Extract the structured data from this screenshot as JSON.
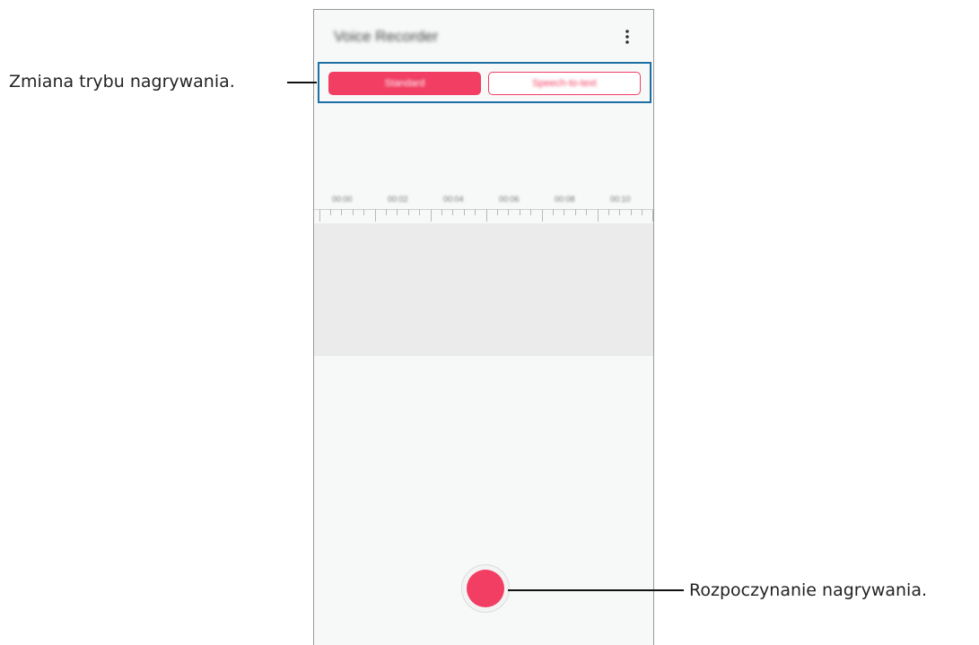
{
  "app": {
    "title": "Voice Recorder",
    "menu_icon": "more-vertical-icon"
  },
  "modes": {
    "active_label": "Standard",
    "inactive_label": "Speech-to-text"
  },
  "timeline": {
    "labels": [
      "00:00",
      "00:02",
      "00:04",
      "00:06",
      "00:08",
      "00:10"
    ]
  },
  "record": {
    "icon": "record-icon",
    "color": "#f23e63"
  },
  "annotations": {
    "mode_change": "Zmiana trybu nagrywania.",
    "start_recording": "Rozpoczynanie nagrywania."
  },
  "colors": {
    "accent": "#f23e63",
    "highlight_border": "#1d6fa5"
  }
}
